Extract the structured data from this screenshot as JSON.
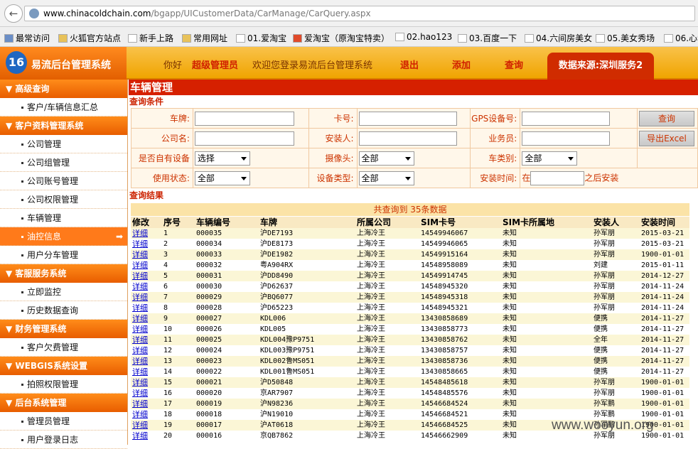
{
  "browser": {
    "back_icon": "back-arrow-icon",
    "url_host": "www.chinacoldchain.com",
    "url_path": "/bgapp/UICustomerData/CarManage/CarQuery.aspx"
  },
  "bookmarks": [
    "最常访问",
    "火狐官方站点",
    "新手上路",
    "常用网址",
    "01.爱淘宝",
    "爱淘宝（原淘宝特卖）",
    "02.hao123",
    "03.百度一下",
    "04.六间房美女",
    "05.美女秀场",
    "06.心动"
  ],
  "header": {
    "logo_text": "易流后台管理系统",
    "greet": "你好",
    "user": "超级管理员",
    "welcome": "欢迎您登录易流后台管理系统",
    "logout": "退出",
    "add": "添加",
    "query": "查询",
    "source": "数据来源:深圳服务2"
  },
  "sidebar": [
    {
      "type": "h",
      "label": "▼ 高级查询"
    },
    {
      "type": "i",
      "label": "客户/车辆信息汇总"
    },
    {
      "type": "h",
      "label": "▼ 客户资料管理系统"
    },
    {
      "type": "i",
      "label": "公司管理"
    },
    {
      "type": "i",
      "label": "公司组管理"
    },
    {
      "type": "i",
      "label": "公司账号管理"
    },
    {
      "type": "i",
      "label": "公司权限管理"
    },
    {
      "type": "i",
      "label": "车辆管理"
    },
    {
      "type": "i",
      "label": "油控信息",
      "active": true
    },
    {
      "type": "i",
      "label": "用户分车管理"
    },
    {
      "type": "h",
      "label": "▼ 客服服务系统"
    },
    {
      "type": "i",
      "label": "立即监控"
    },
    {
      "type": "i",
      "label": "历史数据查询"
    },
    {
      "type": "h",
      "label": "▼ 财务管理系统"
    },
    {
      "type": "i",
      "label": "客户欠费管理"
    },
    {
      "type": "h",
      "label": "▼ WEBGIS系统设置"
    },
    {
      "type": "i",
      "label": "拍照权限管理"
    },
    {
      "type": "h",
      "label": "▼ 后台系统管理"
    },
    {
      "type": "i",
      "label": "管理员管理"
    },
    {
      "type": "i",
      "label": "用户登录日志"
    }
  ],
  "page_title": "车辆管理",
  "query_section": "查询条件",
  "form": {
    "plate": "车牌:",
    "card": "卡号:",
    "gps": "GPS设备号:",
    "query_btn": "查询",
    "company": "公司名:",
    "installer": "安装人:",
    "salesman": "业务员:",
    "export_btn": "导出Excel",
    "own_device": "是否自有设备",
    "own_device_val": "选择",
    "camera": "摄像头:",
    "camera_val": "全部",
    "car_type": "车类别:",
    "car_type_val": "全部",
    "status": "使用状态:",
    "status_val": "全部",
    "dev_type": "设备类型:",
    "dev_type_val": "全部",
    "install_time": "安装时间:",
    "in_text": "在",
    "after_text": "之后安装"
  },
  "result_section": "查询结果",
  "result_count": "共查询到 35条数据",
  "table": {
    "headers": [
      "修改",
      "序号",
      "车辆编号",
      "车牌",
      "所属公司",
      "SIM卡号",
      "SIM卡所属地",
      "安装人",
      "安装时间"
    ],
    "rows": [
      [
        "详细",
        "1",
        "000035",
        "沪DE7193",
        "上海冷王",
        "14549946067",
        "未知",
        "孙军朋",
        "2015-03-21"
      ],
      [
        "详细",
        "2",
        "000034",
        "沪DE8173",
        "上海冷王",
        "14549946065",
        "未知",
        "孙军朋",
        "2015-03-21"
      ],
      [
        "详细",
        "3",
        "000033",
        "沪DE1982",
        "上海冷王",
        "14549915164",
        "未知",
        "孙军朋",
        "1900-01-01"
      ],
      [
        "详细",
        "4",
        "000032",
        "粤A904RX",
        "上海冷王",
        "14548958089",
        "未知",
        "刘建",
        "2015-01-11"
      ],
      [
        "详细",
        "5",
        "000031",
        "沪DD8490",
        "上海冷王",
        "14549914745",
        "未知",
        "孙军朋",
        "2014-12-27"
      ],
      [
        "详细",
        "6",
        "000030",
        "沪D62637",
        "上海冷王",
        "14548945320",
        "未知",
        "孙军朋",
        "2014-11-24"
      ],
      [
        "详细",
        "7",
        "000029",
        "沪BQ6077",
        "上海冷王",
        "14548945318",
        "未知",
        "孙军朋",
        "2014-11-24"
      ],
      [
        "详细",
        "8",
        "000028",
        "沪D65223",
        "上海冷王",
        "14548945321",
        "未知",
        "孙军朋",
        "2014-11-24"
      ],
      [
        "详细",
        "9",
        "000027",
        "KDL006",
        "上海冷王",
        "13430858689",
        "未知",
        "便携",
        "2014-11-27"
      ],
      [
        "详细",
        "10",
        "000026",
        "KDL005",
        "上海冷王",
        "13430858773",
        "未知",
        "便携",
        "2014-11-27"
      ],
      [
        "详细",
        "11",
        "000025",
        "KDL004豫P9751",
        "上海冷王",
        "13430858762",
        "未知",
        "全年",
        "2014-11-27"
      ],
      [
        "详细",
        "12",
        "000024",
        "KDL003豫P9751",
        "上海冷王",
        "13430858757",
        "未知",
        "便携",
        "2014-11-27"
      ],
      [
        "详细",
        "13",
        "000023",
        "KDL002鲁MS051",
        "上海冷王",
        "13430858736",
        "未知",
        "便携",
        "2014-11-27"
      ],
      [
        "详细",
        "14",
        "000022",
        "KDL001鲁MS051",
        "上海冷王",
        "13430858665",
        "未知",
        "便携",
        "2014-11-27"
      ],
      [
        "详细",
        "15",
        "000021",
        "沪D50848",
        "上海冷王",
        "14548485618",
        "未知",
        "孙军朋",
        "1900-01-01"
      ],
      [
        "详细",
        "16",
        "000020",
        "京AR7907",
        "上海冷王",
        "14548485576",
        "未知",
        "孙军朋",
        "1900-01-01"
      ],
      [
        "详细",
        "17",
        "000019",
        "沪N98236",
        "上海冷王",
        "14546684524",
        "未知",
        "孙军鹏",
        "1900-01-01"
      ],
      [
        "详细",
        "18",
        "000018",
        "沪N19010",
        "上海冷王",
        "14546684521",
        "未知",
        "孙军鹏",
        "1900-01-01"
      ],
      [
        "详细",
        "19",
        "000017",
        "沪AT0618",
        "上海冷王",
        "14546684525",
        "未知",
        "孙军鹏",
        "1900-01-01"
      ],
      [
        "详细",
        "20",
        "000016",
        "京QB7862",
        "上海冷王",
        "14546662909",
        "未知",
        "孙军朋",
        "1900-01-01"
      ]
    ]
  },
  "watermark": "www.wooyun.org"
}
